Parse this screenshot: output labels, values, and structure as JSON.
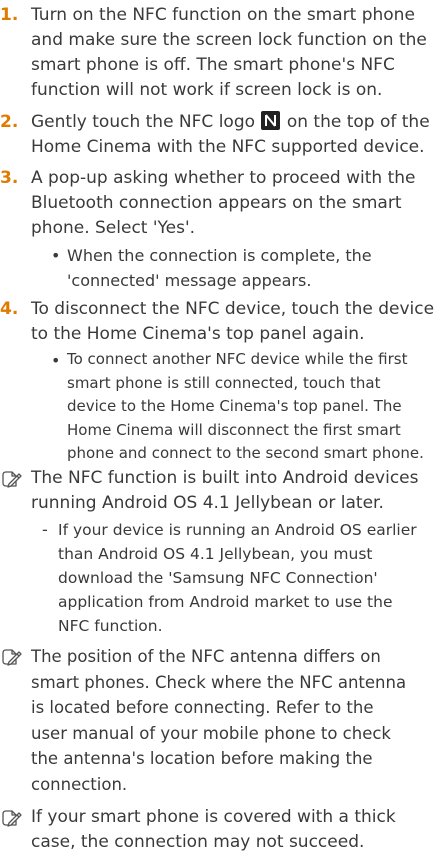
{
  "steps": [
    {
      "num": "1.",
      "lines": [
        "Turn on the NFC function on the smart phone",
        "and make sure the screen lock function on the",
        "smart phone is off. The smart phone's NFC",
        "function will not work if screen lock is on."
      ]
    },
    {
      "num": "2.",
      "line1_before": "Gently touch the NFC logo",
      "line1_after": "on the top of the",
      "line2": "Home Cinema with the NFC supported device."
    },
    {
      "num": "3.",
      "lines": [
        "A pop-up asking whether to proceed with the",
        "Bluetooth connection appears on the smart",
        "phone. Select 'Yes'."
      ],
      "bullet": "•",
      "sub_lines": [
        "When the connection is complete, the",
        "'connected' message appears."
      ]
    },
    {
      "num": "4.",
      "lines": [
        "To disconnect the NFC device, touch the device",
        "to the Home Cinema's top panel again."
      ],
      "bullet": "•",
      "sub_lines": [
        "To connect another NFC device while the first",
        "smart phone is still connected, touch that",
        "device to the Home Cinema's top panel. The",
        "Home Cinema will disconnect the first smart",
        "phone and connect to the second smart phone."
      ]
    }
  ],
  "notes": [
    {
      "lines": [
        "The NFC function is built into Android devices",
        "running Android OS 4.1 Jellybean or later."
      ],
      "dash": "-",
      "dash_lines": [
        "If your device is running an Android OS earlier",
        "than Android OS 4.1 Jellybean, you must",
        "download the 'Samsung NFC Connection'",
        "application from Android market to use the",
        "NFC function."
      ]
    },
    {
      "lines": [
        "The position of the NFC antenna differs on",
        "smart phones. Check where the NFC antenna",
        "is located before connecting. Refer to the",
        "user manual of your mobile phone to check",
        "the antenna's location before making the",
        "connection."
      ]
    },
    {
      "lines": [
        "If your smart phone is covered with a thick",
        "case, the connection may not succeed."
      ]
    }
  ],
  "icons": {
    "note": "pencil-note-icon",
    "nfc": "nfc-logo-icon"
  },
  "colors": {
    "step_number": "#e07b00",
    "text": "#3a3a3a"
  }
}
